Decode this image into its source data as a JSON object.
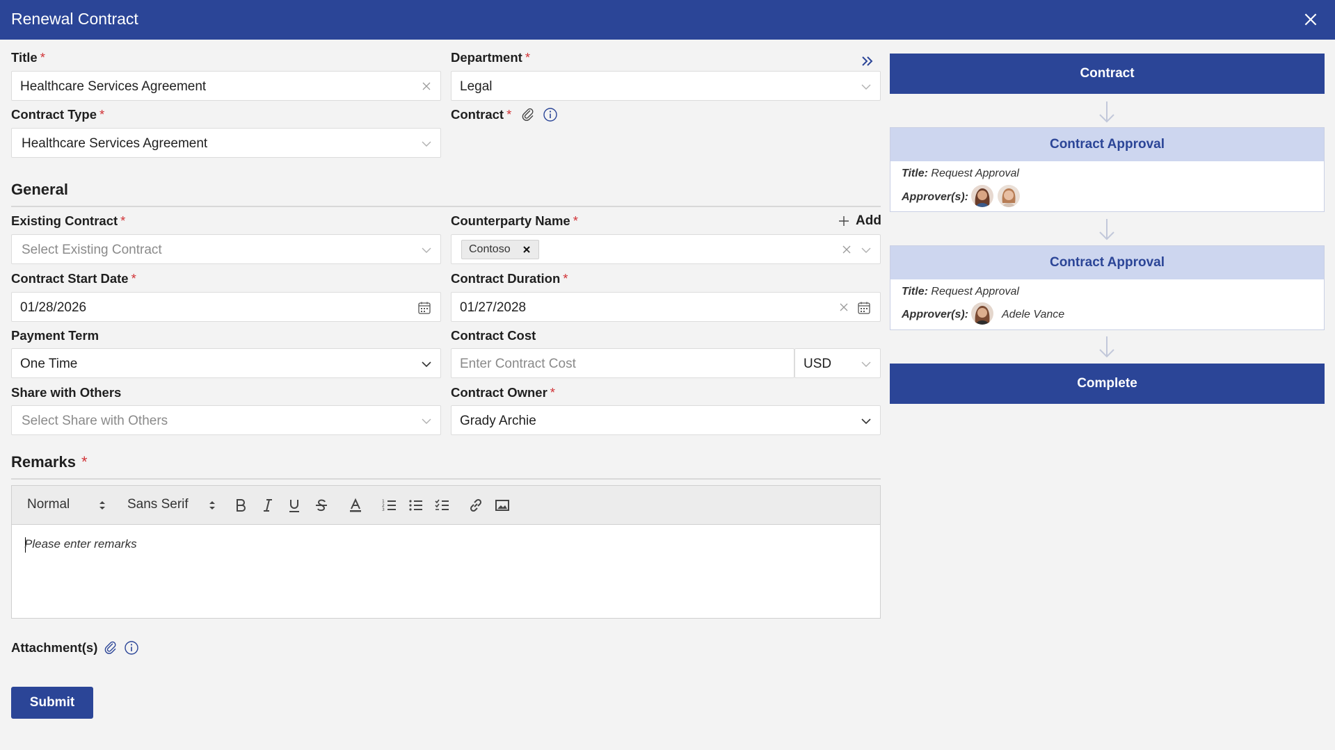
{
  "window": {
    "title": "Renewal Contract"
  },
  "form": {
    "title": {
      "label": "Title",
      "value": "Healthcare Services Agreement"
    },
    "department": {
      "label": "Department",
      "value": "Legal"
    },
    "contract_type": {
      "label": "Contract Type",
      "value": "Healthcare Services Agreement"
    },
    "contract": {
      "label": "Contract"
    },
    "general_heading": "General",
    "existing_contract": {
      "label": "Existing Contract",
      "placeholder": "Select Existing Contract"
    },
    "counterparty": {
      "label": "Counterparty Name",
      "add_label": "Add",
      "chip": "Contoso"
    },
    "start_date": {
      "label": "Contract Start Date",
      "value": "01/28/2026"
    },
    "duration": {
      "label": "Contract Duration",
      "value": "01/27/2028"
    },
    "payment_term": {
      "label": "Payment Term",
      "value": "One Time"
    },
    "cost": {
      "label": "Contract Cost",
      "placeholder": "Enter Contract Cost",
      "currency": "USD"
    },
    "share": {
      "label": "Share with Others",
      "placeholder": "Select Share with Others"
    },
    "owner": {
      "label": "Contract Owner",
      "value": "Grady Archie"
    },
    "remarks": {
      "heading": "Remarks",
      "placeholder": "Please enter remarks"
    },
    "toolbar": {
      "format": "Normal",
      "font": "Sans Serif"
    },
    "attachments": {
      "label": "Attachment(s)"
    },
    "submit_label": "Submit",
    "required_mark": "*"
  },
  "workflow": {
    "start": "Contract",
    "steps": [
      {
        "heading": "Contract Approval",
        "title_label": "Title:",
        "title_value": "Request Approval",
        "approvers_label": "Approver(s):",
        "approver_name": ""
      },
      {
        "heading": "Contract Approval",
        "title_label": "Title:",
        "title_value": "Request Approval",
        "approvers_label": "Approver(s):",
        "approver_name": "Adele Vance"
      }
    ],
    "end": "Complete"
  },
  "icons": {
    "close": "close-icon",
    "expand": "double-chevron-right-icon",
    "chevron": "chevron-down-icon",
    "clear": "clear-icon",
    "calendar": "calendar-icon",
    "paperclip": "paperclip-icon",
    "info": "info-icon",
    "add": "plus-icon"
  },
  "colors": {
    "brand": "#2b4597",
    "required": "#d13438",
    "step_header": "#cdd6ef"
  }
}
